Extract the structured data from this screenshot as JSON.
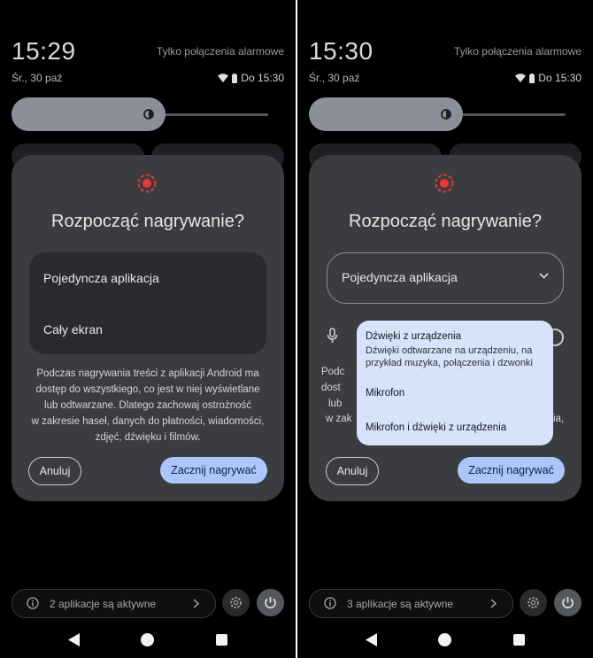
{
  "left": {
    "clock": "15:29",
    "emergency_text": "Tylko połączenia alarmowe",
    "date": "Śr., 30 paź",
    "status_alarm": "Do 15:30",
    "dialog": {
      "title": "Rozpocząć nagrywanie?",
      "menu_items": [
        "Pojedyncza aplikacja",
        "Cały ekran"
      ],
      "description_lines": [
        "Podczas nagrywania treści z aplikacji Android ma",
        "dostęp do wszystkiego, co jest w niej wyświetlane",
        "lub odtwarzane. Dlatego zachowaj ostrożność",
        "w zakresie haseł, danych do płatności, wiadomości,",
        "zdjęć, dźwięku i filmów."
      ],
      "cancel_label": "Anuluj",
      "start_label": "Zacznij nagrywać"
    },
    "active_apps": "2 aplikacje są aktywne"
  },
  "right": {
    "clock": "15:30",
    "emergency_text": "Tylko połączenia alarmowe",
    "date": "Śr., 30 paź",
    "status_alarm": "Do 15:30",
    "dialog": {
      "title": "Rozpocząć nagrywanie?",
      "selected_option": "Pojedyncza aplikacja",
      "desc_fragments": [
        "Podc",
        "dost",
        "lub",
        "w zak",
        "ia,"
      ],
      "cancel_label": "Anuluj",
      "start_label": "Zacznij nagrywać"
    },
    "audio_popup": {
      "title": "Dźwięki z urządzenia",
      "subtitle": "Dźwięki odtwarzane na urządzeniu, na przykład muzyka, połączenia i dzwonki",
      "option_mic": "Mikrofon",
      "option_mic_and_device": "Mikrofon i dźwięki z urządzenia"
    },
    "active_apps": "3 aplikacje są aktywne"
  },
  "colors": {
    "dialog_bg": "#3b3c40",
    "primary_button": "#abc7fa",
    "popup_bg": "#d6e3fb",
    "record_red": "#e53935"
  }
}
